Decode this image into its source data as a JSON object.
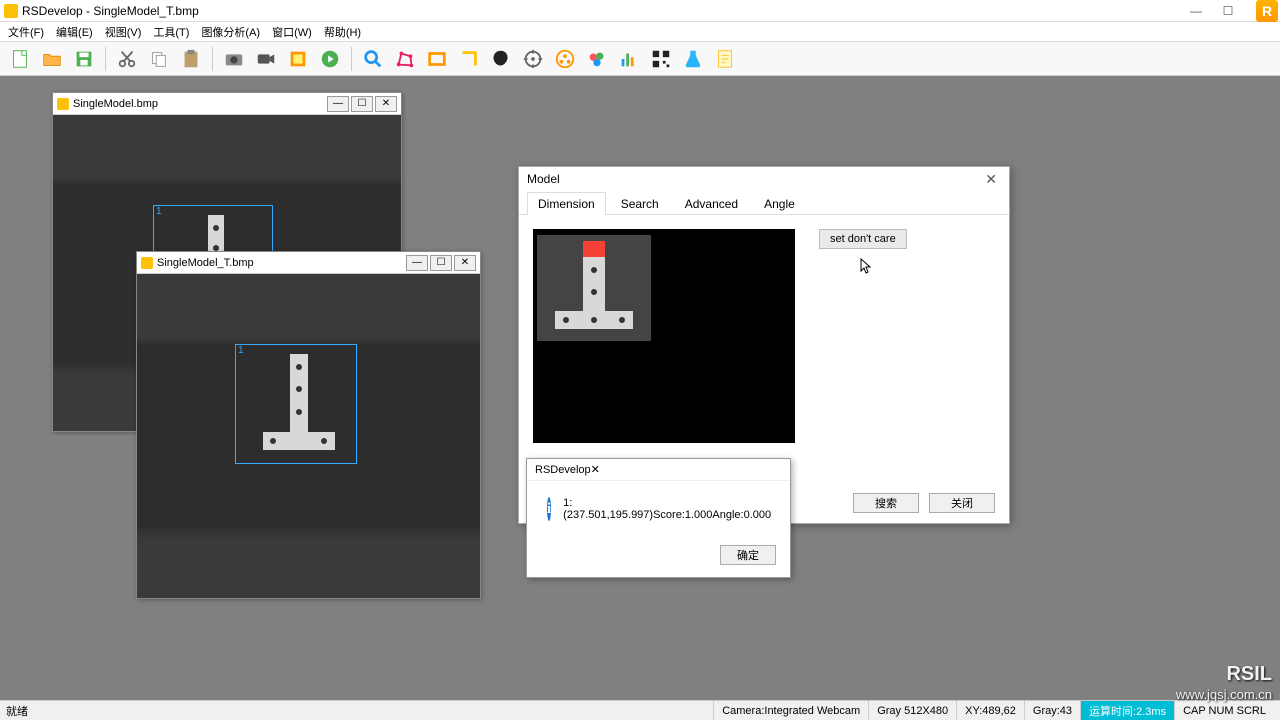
{
  "app": {
    "title": "RSDevelop - SingleModel_T.bmp"
  },
  "menu": {
    "file": "文件(F)",
    "edit": "编辑(E)",
    "view": "视图(V)",
    "tool": "工具(T)",
    "image": "图像分析(A)",
    "window": "窗口(W)",
    "help": "帮助(H)"
  },
  "child1": {
    "title": "SingleModel.bmp",
    "roi_label": "1"
  },
  "child2": {
    "title": "SingleModel_T.bmp",
    "roi_label": "1"
  },
  "model_dlg": {
    "title": "Model",
    "tabs": {
      "dimension": "Dimension",
      "search": "Search",
      "advanced": "Advanced",
      "angle": "Angle"
    },
    "set_dont_care": "set don't care",
    "search_btn": "搜索",
    "close_btn": "关闭"
  },
  "msg": {
    "title": "RSDevelop",
    "text": "1:(237.501,195.997)Score:1.000Angle:0.000",
    "ok": "确定"
  },
  "status": {
    "ready": "就绪",
    "camera": "Camera:Integrated Webcam",
    "gray_size": "Gray 512X480",
    "xy": "XY:489,62",
    "gray_val": "Gray:43",
    "timing": "运算时间:2.3ms",
    "flags": "CAP NUM SCRL"
  },
  "watermark": {
    "l1": "RSIL",
    "l2": "www.jqsj.com.cn"
  }
}
